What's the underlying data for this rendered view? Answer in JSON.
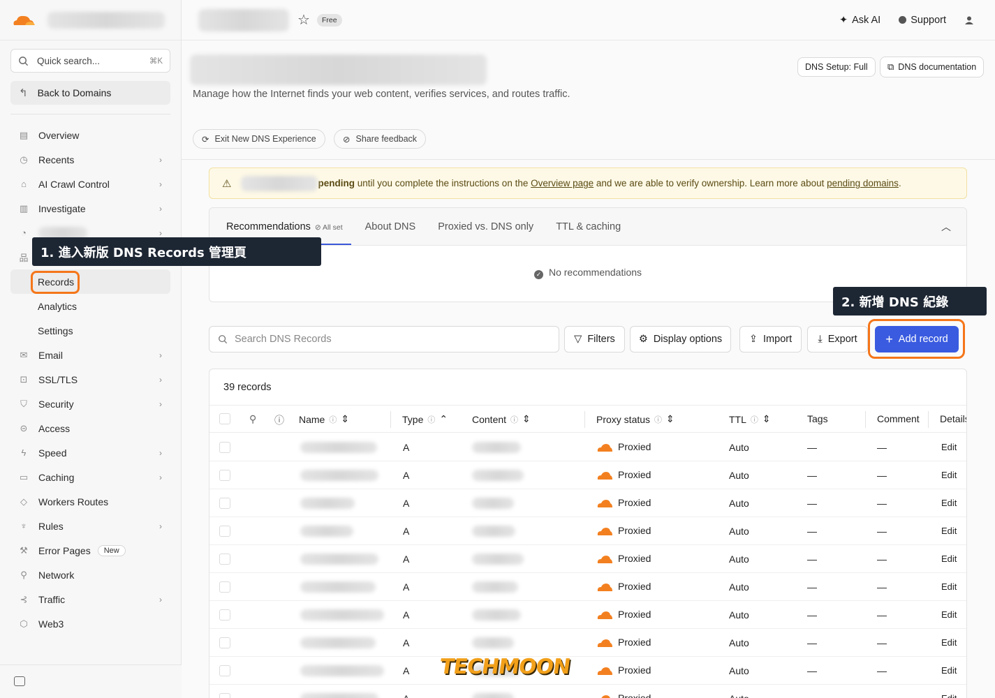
{
  "topbar": {
    "free_badge": "Free",
    "ask_ai": "Ask AI",
    "support": "Support"
  },
  "sidebar": {
    "search_placeholder": "Quick search...",
    "search_shortcut": "⌘K",
    "back_label": "Back to Domains",
    "items": [
      {
        "label": "Overview",
        "icon": "document-icon",
        "chevron": false
      },
      {
        "label": "Recents",
        "icon": "clock-icon",
        "chevron": true
      },
      {
        "label": "AI Crawl Control",
        "icon": "robot-icon",
        "chevron": true
      },
      {
        "label": "Investigate",
        "icon": "chart-icon",
        "chevron": true
      },
      {
        "label": "",
        "icon": "pie-icon",
        "chevron": true
      },
      {
        "label": "",
        "icon": "dns-tree-icon",
        "chevron": false
      },
      {
        "label": "Records",
        "sub": true,
        "active": true
      },
      {
        "label": "Analytics",
        "sub": true
      },
      {
        "label": "Settings",
        "sub": true
      },
      {
        "label": "Email",
        "icon": "email-icon",
        "chevron": true
      },
      {
        "label": "SSL/TLS",
        "icon": "lock-icon",
        "chevron": true
      },
      {
        "label": "Security",
        "icon": "shield-icon",
        "chevron": true
      },
      {
        "label": "Access",
        "icon": "access-icon",
        "chevron": false
      },
      {
        "label": "Speed",
        "icon": "bolt-icon",
        "chevron": true
      },
      {
        "label": "Caching",
        "icon": "cache-icon",
        "chevron": true
      },
      {
        "label": "Workers Routes",
        "icon": "workers-icon",
        "chevron": false
      },
      {
        "label": "Rules",
        "icon": "rules-icon",
        "chevron": true
      },
      {
        "label": "Error Pages",
        "icon": "wrench-icon",
        "chevron": false,
        "badge": "New"
      },
      {
        "label": "Network",
        "icon": "pin-icon",
        "chevron": false
      },
      {
        "label": "Traffic",
        "icon": "traffic-icon",
        "chevron": true
      },
      {
        "label": "Web3",
        "icon": "web3-icon",
        "chevron": false
      }
    ]
  },
  "header": {
    "subtitle": "Manage how the Internet finds your web content, verifies services, and routes traffic.",
    "dns_setup": "DNS Setup: Full",
    "dns_docs": "DNS documentation",
    "exit_btn": "Exit New DNS Experience",
    "feedback_btn": "Share feedback"
  },
  "warning": {
    "bold": "pending",
    "text1": " until you complete the instructions on the ",
    "link1": "Overview page",
    "text2": " and we are able to verify ownership. Learn more about ",
    "link2": "pending domains",
    "text3": "."
  },
  "recommendations": {
    "tabs": [
      "Recommendations",
      "About DNS",
      "Proxied vs. DNS only",
      "TTL & caching"
    ],
    "all_set": "All set",
    "empty": "No recommendations"
  },
  "toolbar": {
    "search_placeholder": "Search DNS Records",
    "filters": "Filters",
    "display": "Display options",
    "import": "Import",
    "export": "Export",
    "add": "Add record"
  },
  "records": {
    "count": "39 records",
    "columns": {
      "name": "Name",
      "type": "Type",
      "content": "Content",
      "proxy": "Proxy status",
      "ttl": "TTL",
      "tags": "Tags",
      "comment": "Comment",
      "details": "Details"
    },
    "rows": [
      {
        "type": "A",
        "proxy": "Proxied",
        "ttl": "Auto",
        "tags": "—",
        "comment": "—",
        "action": "Edit"
      },
      {
        "type": "A",
        "proxy": "Proxied",
        "ttl": "Auto",
        "tags": "—",
        "comment": "—",
        "action": "Edit"
      },
      {
        "type": "A",
        "proxy": "Proxied",
        "ttl": "Auto",
        "tags": "—",
        "comment": "—",
        "action": "Edit"
      },
      {
        "type": "A",
        "proxy": "Proxied",
        "ttl": "Auto",
        "tags": "—",
        "comment": "—",
        "action": "Edit"
      },
      {
        "type": "A",
        "proxy": "Proxied",
        "ttl": "Auto",
        "tags": "—",
        "comment": "—",
        "action": "Edit"
      },
      {
        "type": "A",
        "proxy": "Proxied",
        "ttl": "Auto",
        "tags": "—",
        "comment": "—",
        "action": "Edit"
      },
      {
        "type": "A",
        "proxy": "Proxied",
        "ttl": "Auto",
        "tags": "—",
        "comment": "—",
        "action": "Edit"
      },
      {
        "type": "A",
        "proxy": "Proxied",
        "ttl": "Auto",
        "tags": "—",
        "comment": "—",
        "action": "Edit"
      },
      {
        "type": "A",
        "proxy": "Proxied",
        "ttl": "Auto",
        "tags": "—",
        "comment": "—",
        "action": "Edit"
      },
      {
        "type": "A",
        "proxy": "Proxied",
        "ttl": "Auto",
        "tags": "—",
        "comment": "—",
        "action": "Edit"
      }
    ]
  },
  "annotations": {
    "step1": "1. 進入新版 DNS Records 管理頁",
    "step2": "2. 新增 DNS 紀錄"
  },
  "watermark": "TECHMOON",
  "colors": {
    "accent": "#3a5be0",
    "cloud": "#f38020",
    "annotation": "#f5761a"
  }
}
